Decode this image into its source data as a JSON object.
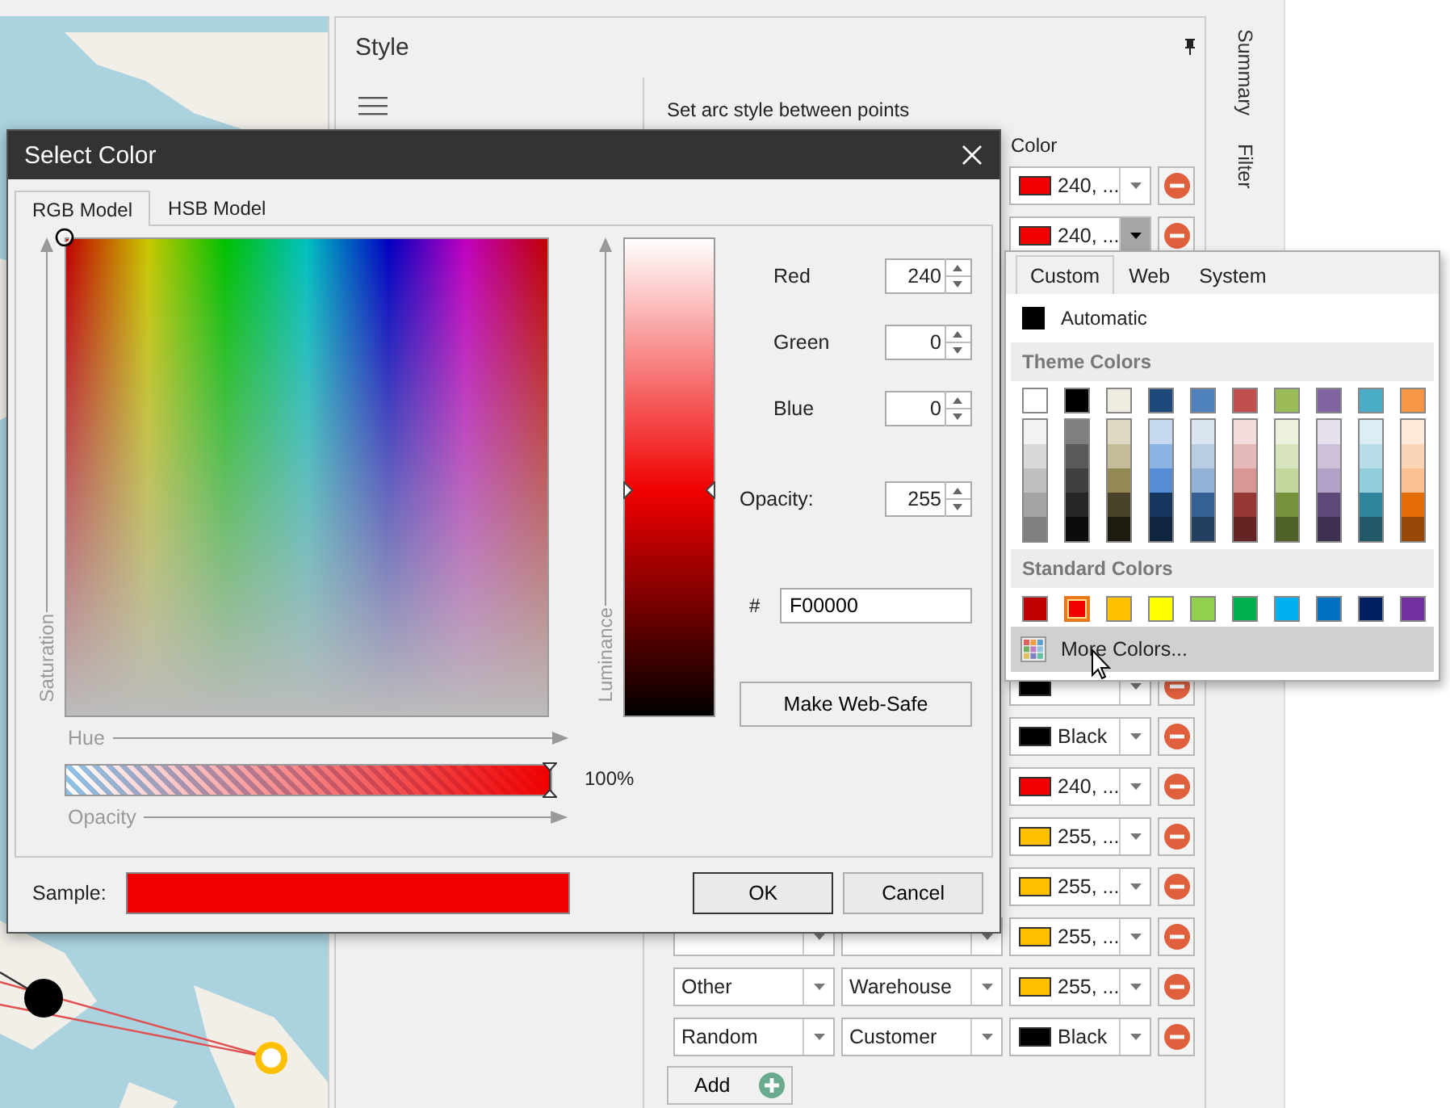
{
  "style_panel": {
    "title": "Style",
    "subtitle": "Set arc style between points",
    "column_header": "Color",
    "add_button": "Add",
    "rows": [
      {
        "color": "#f00000",
        "color_label": "240, ...",
        "open": false
      },
      {
        "color": "#f00000",
        "color_label": "240, ...",
        "open": true
      },
      {},
      {},
      {},
      {},
      {},
      {},
      {},
      {},
      {
        "color": "#000000",
        "open": false
      },
      {
        "color": "#000000",
        "color_label": "Black",
        "open": false
      },
      {
        "color": "#f00000",
        "color_label": "240, ...",
        "open": false
      },
      {
        "color": "#ffc000",
        "color_label": "255, ...",
        "open": false
      },
      {
        "color": "#ffc000",
        "color_label": "255, ...",
        "open": false
      },
      {
        "boxes": true,
        "color": "#ffc000",
        "color_label": "255, ...",
        "open": false
      },
      {
        "source": "Other",
        "target": "Warehouse",
        "color": "#ffc000",
        "color_label": "255, ...",
        "open": false
      },
      {
        "source": "Random",
        "target": "Customer",
        "color": "#000000",
        "color_label": "Black",
        "open": false
      }
    ]
  },
  "side_tabs": [
    {
      "label": "Summary"
    },
    {
      "label": "Filter"
    }
  ],
  "dialog": {
    "title": "Select Color",
    "tabs": [
      {
        "label": "RGB Model",
        "selected": true
      },
      {
        "label": "HSB Model",
        "selected": false
      }
    ],
    "saturation_label": "Saturation",
    "hue_label": "Hue",
    "opacity_label": "Opacity",
    "luminance_label": "Luminance",
    "luminance": {
      "level": 0.475
    },
    "opacity_bar": {
      "level": 1
    },
    "opacity_percent": "100%",
    "channels": [
      {
        "label": "Red",
        "value": "240"
      },
      {
        "label": "Green",
        "value": "0"
      },
      {
        "label": "Blue",
        "value": "0"
      }
    ],
    "opacity": {
      "label": "Opacity:",
      "value": "255"
    },
    "hex": {
      "label": "#",
      "value": "F00000"
    },
    "web_safe_button": "Make Web-Safe",
    "sample": {
      "label": "Sample:",
      "color": "#f00000"
    },
    "buttons": [
      {
        "label": "OK",
        "default": true
      },
      {
        "label": "Cancel",
        "default": false
      }
    ]
  },
  "color_popup": {
    "tabs": [
      {
        "label": "Custom",
        "selected": true
      },
      {
        "label": "Web",
        "selected": false
      },
      {
        "label": "System",
        "selected": false
      }
    ],
    "automatic": {
      "label": "Automatic",
      "color": "#000000"
    },
    "theme_header": "Theme Colors",
    "theme_colors": [
      {
        "color": "#ffffff",
        "shades": [
          {
            "color": "#f2f2f2"
          },
          {
            "color": "#d8d8d8"
          },
          {
            "color": "#bfbfbf"
          },
          {
            "color": "#a5a5a5"
          },
          {
            "color": "#7f7f7f"
          }
        ]
      },
      {
        "color": "#000000",
        "shades": [
          {
            "color": "#7f7f7f"
          },
          {
            "color": "#595959"
          },
          {
            "color": "#3f3f3f"
          },
          {
            "color": "#262626"
          },
          {
            "color": "#0c0c0c"
          }
        ]
      },
      {
        "color": "#eeece1",
        "shades": [
          {
            "color": "#ddd9c3"
          },
          {
            "color": "#c4bd97"
          },
          {
            "color": "#938953"
          },
          {
            "color": "#494429"
          },
          {
            "color": "#1d1b10"
          }
        ]
      },
      {
        "color": "#1f497d",
        "shades": [
          {
            "color": "#c6d9f0"
          },
          {
            "color": "#8db3e2"
          },
          {
            "color": "#548dd4"
          },
          {
            "color": "#17365d"
          },
          {
            "color": "#0f243e"
          }
        ]
      },
      {
        "color": "#4f81bd",
        "shades": [
          {
            "color": "#dbe5f1"
          },
          {
            "color": "#b8cce4"
          },
          {
            "color": "#95b3d7"
          },
          {
            "color": "#366092"
          },
          {
            "color": "#244061"
          }
        ]
      },
      {
        "color": "#c0504d",
        "shades": [
          {
            "color": "#f2dcdb"
          },
          {
            "color": "#e5b9b7"
          },
          {
            "color": "#d99694"
          },
          {
            "color": "#953734"
          },
          {
            "color": "#632423"
          }
        ]
      },
      {
        "color": "#9bbb59",
        "shades": [
          {
            "color": "#ebf1dd"
          },
          {
            "color": "#d7e3bc"
          },
          {
            "color": "#c3d69b"
          },
          {
            "color": "#76923c"
          },
          {
            "color": "#4f6128"
          }
        ]
      },
      {
        "color": "#8064a2",
        "shades": [
          {
            "color": "#e5e0ec"
          },
          {
            "color": "#ccc1d9"
          },
          {
            "color": "#b2a2c7"
          },
          {
            "color": "#5f497a"
          },
          {
            "color": "#3f3151"
          }
        ]
      },
      {
        "color": "#4bacc6",
        "shades": [
          {
            "color": "#dbeef3"
          },
          {
            "color": "#b7dde8"
          },
          {
            "color": "#92cddc"
          },
          {
            "color": "#31859b"
          },
          {
            "color": "#205867"
          }
        ]
      },
      {
        "color": "#f79646",
        "shades": [
          {
            "color": "#fdeada"
          },
          {
            "color": "#fbd5b5"
          },
          {
            "color": "#fac08f"
          },
          {
            "color": "#e36c09"
          },
          {
            "color": "#974806"
          }
        ]
      }
    ],
    "standard_header": "Standard Colors",
    "standard_colors": [
      {
        "color": "#c00000",
        "selected": false
      },
      {
        "color": "#f00000",
        "selected": true
      },
      {
        "color": "#ffc000",
        "selected": false
      },
      {
        "color": "#ffff00",
        "selected": false
      },
      {
        "color": "#92d050",
        "selected": false
      },
      {
        "color": "#00b050",
        "selected": false
      },
      {
        "color": "#00b0f0",
        "selected": false
      },
      {
        "color": "#0070c0",
        "selected": false
      },
      {
        "color": "#002060",
        "selected": false
      },
      {
        "color": "#7030a0",
        "selected": false
      }
    ],
    "more_colors": {
      "label": "More Colors...",
      "hovered": true
    }
  }
}
